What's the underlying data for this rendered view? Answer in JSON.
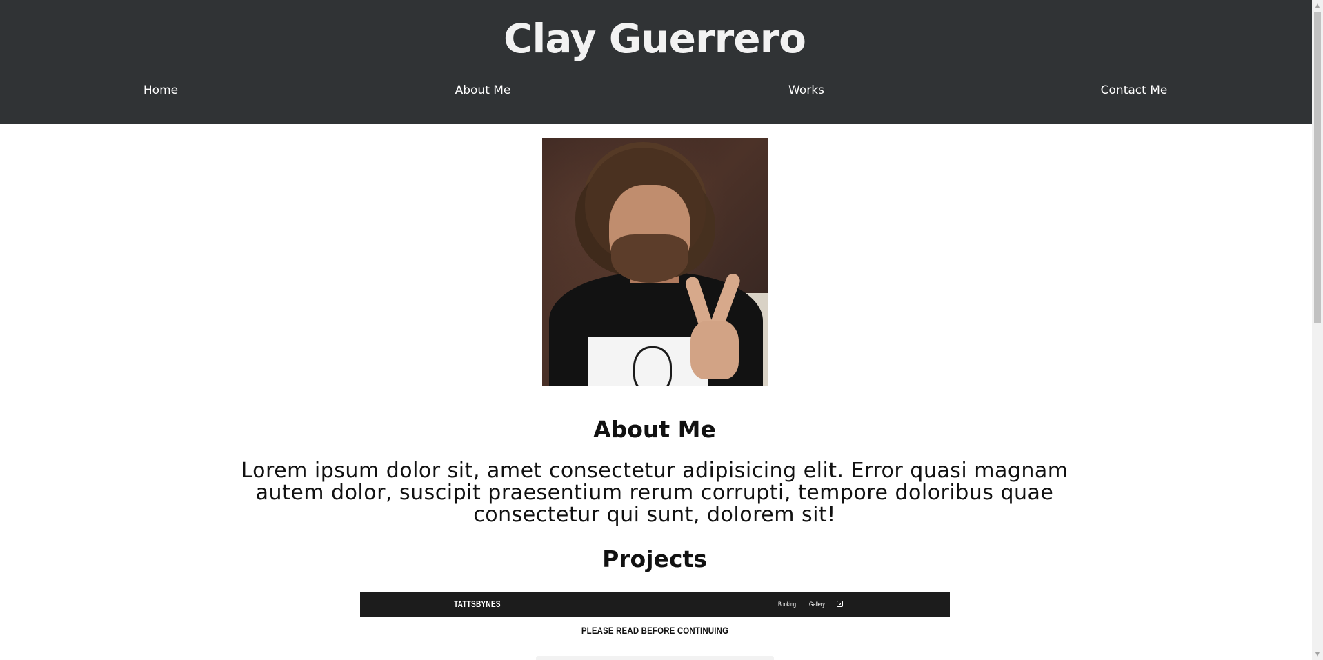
{
  "site": {
    "title": "Clay Guerrero"
  },
  "nav": {
    "items": [
      {
        "label": "Home"
      },
      {
        "label": "About Me"
      },
      {
        "label": "Works"
      },
      {
        "label": "Contact Me"
      }
    ]
  },
  "about": {
    "heading": "About Me",
    "text": "Lorem ipsum dolor sit, amet consectetur adipisicing elit. Error quasi magnam autem dolor, suscipit praesentium rerum corrupti, tempore doloribus quae consectetur qui sunt, dolorem sit!"
  },
  "projects": {
    "heading": "Projects",
    "preview": {
      "brand": "TATTSBYNES",
      "nav": [
        "Booking",
        "Gallery"
      ],
      "icon": "instagram-icon",
      "notice": "PLEASE READ BEFORE CONTINUING"
    }
  },
  "colors": {
    "header_bg": "#303335",
    "header_text": "#f2f2f2",
    "page_bg": "#ffffff",
    "text": "#111111",
    "preview_bar": "#1c1c1c"
  }
}
